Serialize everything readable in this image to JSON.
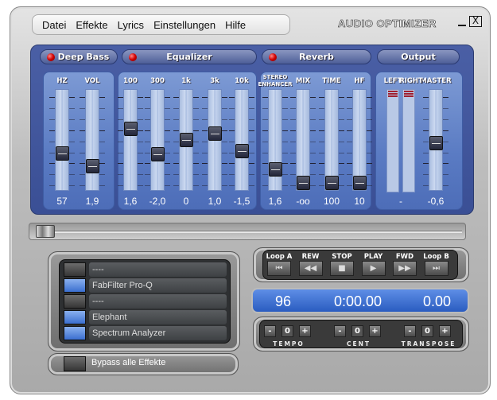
{
  "menu": [
    "Datei",
    "Effekte",
    "Lyrics",
    "Einstellungen",
    "Hilfe"
  ],
  "app_title": "AUDIO OPTIMIZER",
  "window_controls": {
    "minimize": "_",
    "close": "X"
  },
  "colors": {
    "panel_blue": "#4a5fa5",
    "led_red": "#d00000",
    "display_blue": "#3a6fd0",
    "fx_on": "#3b6fd0"
  },
  "tabs": [
    {
      "label": "Deep Bass",
      "led": true
    },
    {
      "label": "Equalizer",
      "led": true
    },
    {
      "label": "Reverb",
      "led": true
    },
    {
      "label": "Output",
      "led": false
    }
  ],
  "sliders": [
    {
      "label": "HZ",
      "value": "57",
      "level": 0.34
    },
    {
      "label": "VOL",
      "value": "1,9",
      "level": 0.2
    },
    {
      "label": "100",
      "value": "1,6",
      "level": 0.61
    },
    {
      "label": "300",
      "value": "-2,0",
      "level": 0.33
    },
    {
      "label": "1k",
      "value": "0",
      "level": 0.49
    },
    {
      "label": "3k",
      "value": "1,0",
      "level": 0.56
    },
    {
      "label": "10k",
      "value": "-1,5",
      "level": 0.37
    },
    {
      "label": "STEREO ENHANCER",
      "value": "1,6",
      "level": 0.17
    },
    {
      "label": "MIX",
      "value": "-oo",
      "level": 0.02
    },
    {
      "label": "TIME",
      "value": "100",
      "level": 0.02
    },
    {
      "label": "HF",
      "value": "10",
      "level": 0.02
    },
    {
      "label": "MASTER",
      "value": "-0,6",
      "level": 0.46
    }
  ],
  "meters": {
    "left_label": "LEFT",
    "right_label": "RIGHT",
    "value": "-"
  },
  "position_level": 0.0,
  "effects": [
    {
      "name": "----",
      "enabled": false
    },
    {
      "name": "FabFilter Pro-Q",
      "enabled": true
    },
    {
      "name": "----",
      "enabled": false
    },
    {
      "name": "Elephant",
      "enabled": true
    },
    {
      "name": "Spectrum Analyzer",
      "enabled": true
    }
  ],
  "bypass": {
    "label": "Bypass alle Effekte",
    "enabled": false
  },
  "transport": [
    {
      "label": "Loop A",
      "icon": "⏮"
    },
    {
      "label": "REW",
      "icon": "◀◀"
    },
    {
      "label": "STOP",
      "icon": "■"
    },
    {
      "label": "PLAY",
      "icon": "▶"
    },
    {
      "label": "FWD",
      "icon": "▶▶"
    },
    {
      "label": "Loop B",
      "icon": "⏭"
    }
  ],
  "display": {
    "bpm": "96",
    "time": "0:00.00",
    "pitch": "0.00"
  },
  "pitch_controls": [
    {
      "label": "TEMPO",
      "value": "0",
      "minus": "-",
      "plus": "+"
    },
    {
      "label": "CENT",
      "value": "0",
      "minus": "-",
      "plus": "+"
    },
    {
      "label": "TRANSPOSE",
      "value": "0",
      "minus": "-",
      "plus": "+"
    }
  ]
}
